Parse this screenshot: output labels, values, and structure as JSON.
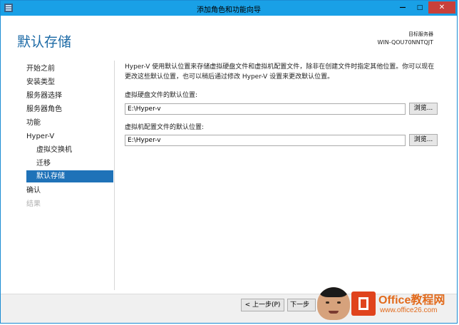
{
  "window": {
    "title": "添加角色和功能向导",
    "minimize_label": "—",
    "maximize_label": "□",
    "close_label": "✕"
  },
  "header": {
    "page_title": "默认存储",
    "server_label": "目标服务器",
    "server_name": "WIN-QOU70NNTQJT"
  },
  "sidebar": {
    "items": [
      {
        "label": "开始之前",
        "state": "normal"
      },
      {
        "label": "安装类型",
        "state": "normal"
      },
      {
        "label": "服务器选择",
        "state": "normal"
      },
      {
        "label": "服务器角色",
        "state": "normal"
      },
      {
        "label": "功能",
        "state": "normal"
      },
      {
        "label": "Hyper-V",
        "state": "normal"
      },
      {
        "label": "虚拟交换机",
        "state": "sub"
      },
      {
        "label": "迁移",
        "state": "sub"
      },
      {
        "label": "默认存储",
        "state": "active"
      },
      {
        "label": "确认",
        "state": "normal"
      },
      {
        "label": "结果",
        "state": "disabled"
      }
    ]
  },
  "main": {
    "description": "Hyper-V 使用默认位置来存储虚拟硬盘文件和虚拟机配置文件，除非在创建文件时指定其他位置。你可以现在更改这些默认位置，也可以稍后通过修改 Hyper-V 设置来更改默认位置。",
    "vhd_label": "虚拟硬盘文件的默认位置:",
    "vhd_path": "E:\\Hyper-v",
    "config_label": "虚拟机配置文件的默认位置:",
    "config_path": "E:\\Hyper-v",
    "browse_label": "浏览..."
  },
  "footer": {
    "prev_label": "< 上一步(P)",
    "next_label": "下一步"
  },
  "watermark": {
    "line1": "Office教程网",
    "line2": "www.office26.com"
  },
  "colors": {
    "titlebar": "#19a0e6",
    "accent": "#1f72b8",
    "page_title": "#1c6aa6",
    "close_button": "#c8403a"
  }
}
